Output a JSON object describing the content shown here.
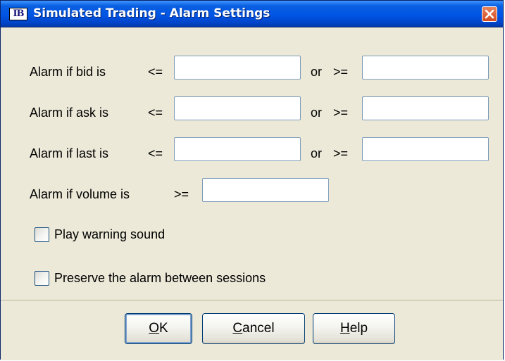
{
  "window": {
    "title": "Simulated Trading - Alarm Settings",
    "app_icon_text": "IB"
  },
  "rows": {
    "bid": {
      "label": "Alarm if bid is",
      "le": "<=",
      "or": "or",
      "ge": ">=",
      "low_value": "",
      "high_value": ""
    },
    "ask": {
      "label": "Alarm if ask is",
      "le": "<=",
      "or": "or",
      "ge": ">=",
      "low_value": "",
      "high_value": ""
    },
    "last": {
      "label": "Alarm if last is",
      "le": "<=",
      "or": "or",
      "ge": ">=",
      "low_value": "",
      "high_value": ""
    },
    "volume": {
      "label": "Alarm if volume is",
      "ge": ">=",
      "value": ""
    }
  },
  "options": {
    "play_sound": {
      "label": "Play warning sound",
      "checked": false
    },
    "preserve": {
      "label": "Preserve the alarm between sessions",
      "checked": false
    }
  },
  "buttons": {
    "ok": {
      "mnemonic": "O",
      "rest": "K"
    },
    "cancel": {
      "mnemonic": "C",
      "rest": "ancel"
    },
    "help": {
      "mnemonic": "H",
      "rest": "elp"
    }
  },
  "colors": {
    "title_bar": "#0055e5",
    "dialog_bg": "#ece9d8",
    "close_button": "#d5491d",
    "input_border": "#7f9db9"
  },
  "icons": {
    "app": "ib-logo-icon",
    "close": "close-icon"
  }
}
